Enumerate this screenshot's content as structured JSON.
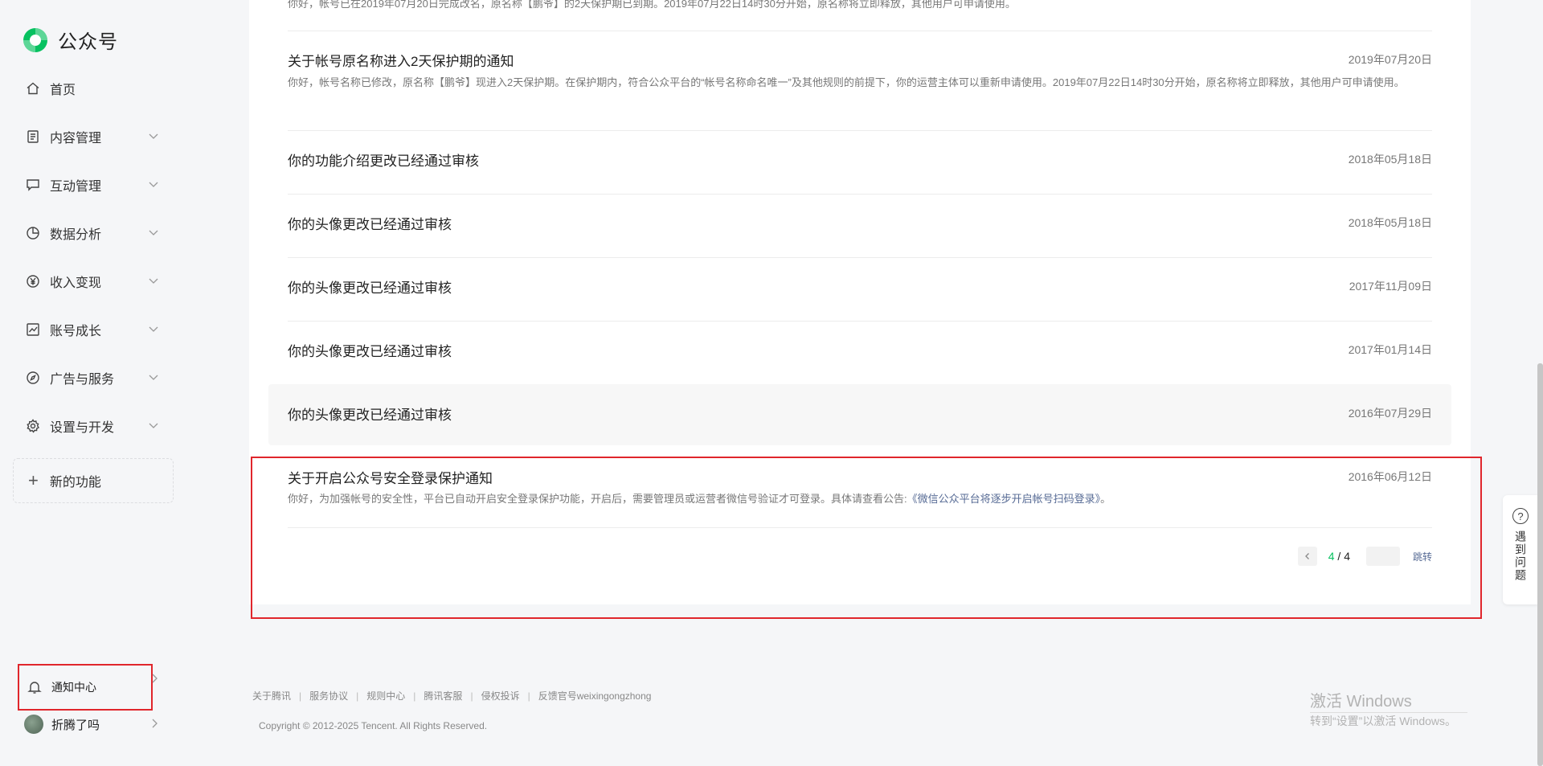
{
  "app": {
    "name": "公众号"
  },
  "sidebar": {
    "items": [
      {
        "label": "首页",
        "icon": "home-icon",
        "expandable": false
      },
      {
        "label": "内容管理",
        "icon": "document-icon",
        "expandable": true
      },
      {
        "label": "互动管理",
        "icon": "chat-icon",
        "expandable": true
      },
      {
        "label": "数据分析",
        "icon": "pie-chart-icon",
        "expandable": true
      },
      {
        "label": "收入变现",
        "icon": "yuan-icon",
        "expandable": true
      },
      {
        "label": "账号成长",
        "icon": "trend-chart-icon",
        "expandable": true
      },
      {
        "label": "广告与服务",
        "icon": "compass-icon",
        "expandable": true
      },
      {
        "label": "设置与开发",
        "icon": "gear-icon",
        "expandable": true
      }
    ],
    "new_feature": "新的功能",
    "notification_center": "通知中心",
    "user_name": "折腾了吗"
  },
  "notifications": {
    "top_snippet": "你好，帐号已在2019年07月20日完成改名，原名称【鹏爷】的2天保护期已到期。2019年07月22日14时30分开始，原名称将立即释放，其他用户可申请使用。",
    "items": [
      {
        "title": "关于帐号原名称进入2天保护期的通知",
        "date": "2019年07月20日",
        "desc": "你好，帐号名称已修改，原名称【鹏爷】现进入2天保护期。在保护期内，符合公众平台的“帐号名称命名唯一”及其他规则的前提下，你的运营主体可以重新申请使用。2019年07月22日14时30分开始，原名称将立即释放，其他用户可申请使用。"
      },
      {
        "title": "你的功能介绍更改已经通过审核",
        "date": "2018年05月18日"
      },
      {
        "title": "你的头像更改已经通过审核",
        "date": "2018年05月18日"
      },
      {
        "title": "你的头像更改已经通过审核",
        "date": "2017年11月09日"
      },
      {
        "title": "你的头像更改已经通过审核",
        "date": "2017年01月14日"
      },
      {
        "title": "你的头像更改已经通过审核",
        "date": "2016年07月29日"
      },
      {
        "title": "关于开启公众号安全登录保护通知",
        "date": "2016年06月12日",
        "desc_prefix": "你好，为加强帐号的安全性，平台已自动开启安全登录保护功能，开启后，需要管理员或运营者微信号验证才可登录。具体请查看公告:",
        "desc_link": "《微信公众平台将逐步开启帐号扫码登录》",
        "desc_suffix": "。"
      }
    ]
  },
  "pagination": {
    "current": "4",
    "separator": " / ",
    "total": "4",
    "jump_label": "跳转",
    "input_value": ""
  },
  "footer": {
    "links": [
      "关于腾讯",
      "服务协议",
      "规则中心",
      "腾讯客服",
      "侵权投诉",
      "反馈官号weixingongzhong"
    ],
    "separator": "|",
    "copyright": "Copyright © 2012-2025 Tencent. All Rights Reserved."
  },
  "help": {
    "label": "遇到问题",
    "icon": "question-icon"
  },
  "watermark": {
    "line1": "激活 Windows",
    "line2": "转到“设置”以激活 Windows。"
  },
  "colors": {
    "brand": "#07c160",
    "link": "#576b95",
    "highlight_box": "#e0262c"
  }
}
